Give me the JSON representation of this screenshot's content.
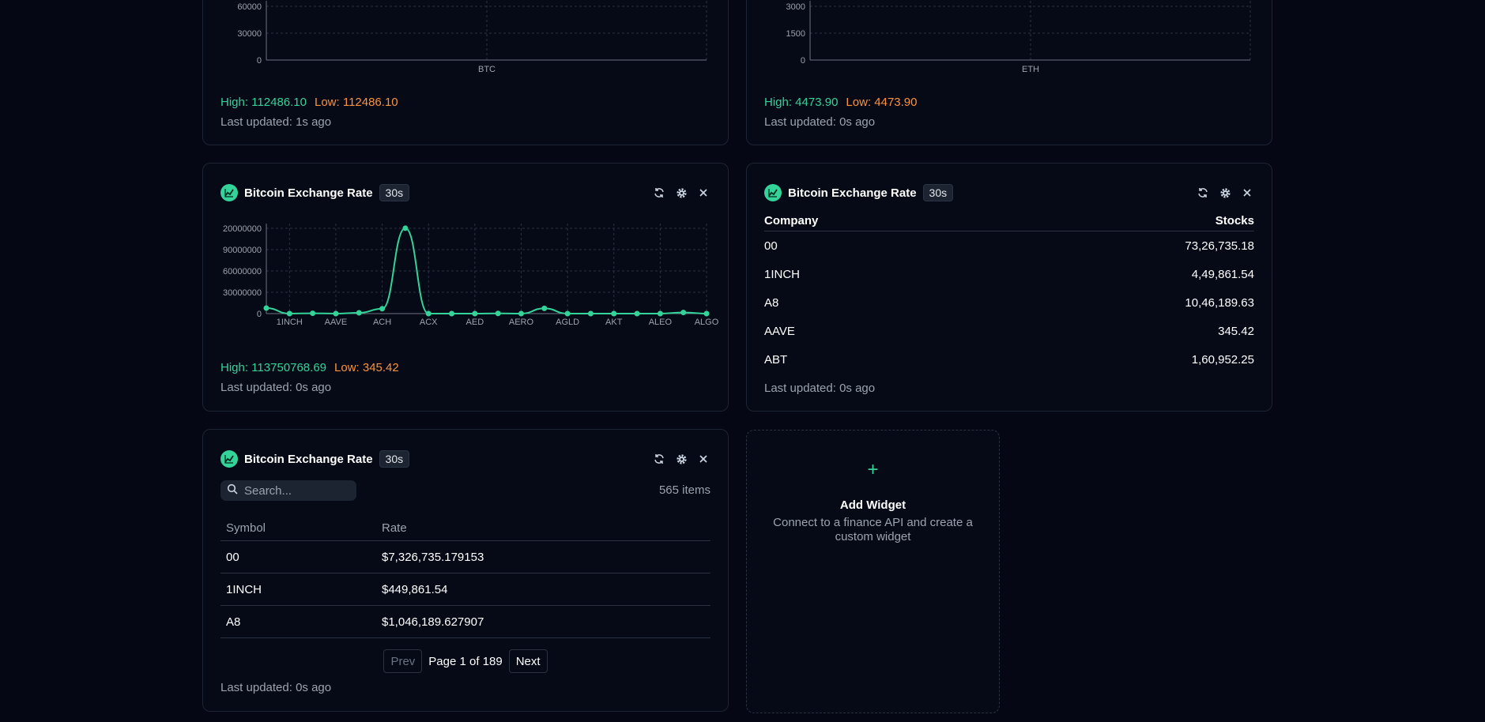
{
  "top_left": {
    "y_ticks": [
      "60000",
      "30000",
      "0"
    ],
    "x_label": "BTC",
    "high": "High: 112486.10",
    "low": "Low: 112486.10",
    "updated": "Last updated: 1s ago"
  },
  "top_right": {
    "y_ticks": [
      "3000",
      "1500",
      "0"
    ],
    "x_label": "ETH",
    "high": "High: 4473.90",
    "low": "Low: 4473.90",
    "updated": "Last updated: 0s ago"
  },
  "line_widget": {
    "title": "Bitcoin Exchange Rate",
    "interval": "30s",
    "high": "High: 113750768.69",
    "low": "Low: 345.42",
    "updated": "Last updated: 0s ago"
  },
  "table_widget": {
    "title": "Bitcoin Exchange Rate",
    "interval": "30s",
    "col_company": "Company",
    "col_stocks": "Stocks",
    "rows": [
      {
        "company": "00",
        "stocks": "73,26,735.18"
      },
      {
        "company": "1INCH",
        "stocks": "4,49,861.54"
      },
      {
        "company": "A8",
        "stocks": "10,46,189.63"
      },
      {
        "company": "AAVE",
        "stocks": "345.42"
      },
      {
        "company": "ABT",
        "stocks": "1,60,952.25"
      }
    ],
    "updated": "Last updated: 0s ago"
  },
  "list_widget": {
    "title": "Bitcoin Exchange Rate",
    "interval": "30s",
    "search_placeholder": "Search...",
    "count": "565 items",
    "col_symbol": "Symbol",
    "col_rate": "Rate",
    "rows": [
      {
        "symbol": "00",
        "rate": "$7,326,735.179153"
      },
      {
        "symbol": "1INCH",
        "rate": "$449,861.54"
      },
      {
        "symbol": "A8",
        "rate": "$1,046,189.627907"
      }
    ],
    "prev": "Prev",
    "page": "Page 1 of 189",
    "next": "Next",
    "updated": "Last updated: 0s ago"
  },
  "add_widget": {
    "plus": "+",
    "title": "Add Widget",
    "desc": "Connect to a finance API and create a custom widget"
  },
  "colors": {
    "accent": "#34d399",
    "low": "#fb923c",
    "bg": "#050814",
    "card": "#060a17"
  },
  "chart_data": [
    {
      "type": "bar",
      "categories": [
        "BTC"
      ],
      "values": [
        112486.1
      ],
      "ylim": [
        0,
        60000
      ]
    },
    {
      "type": "bar",
      "categories": [
        "ETH"
      ],
      "values": [
        4473.9
      ],
      "ylim": [
        0,
        3000
      ]
    },
    {
      "type": "line",
      "x_tick_labels": [
        "1INCH",
        "AAVE",
        "ACH",
        "ACX",
        "AED",
        "AERO",
        "AGLD",
        "AKT",
        "ALEO",
        "ALGO"
      ],
      "y_tick_labels": [
        "20000000",
        "90000000",
        "60000000",
        "30000000",
        "0"
      ],
      "ylim": [
        0,
        120000000
      ],
      "series": [
        {
          "values": [
            7326735,
            0,
            449861,
            0,
            1046189,
            6500000,
            113750768,
            0,
            0,
            0,
            300000,
            0,
            7000000,
            0,
            0,
            0,
            0,
            0,
            1500000,
            0
          ]
        }
      ]
    }
  ]
}
